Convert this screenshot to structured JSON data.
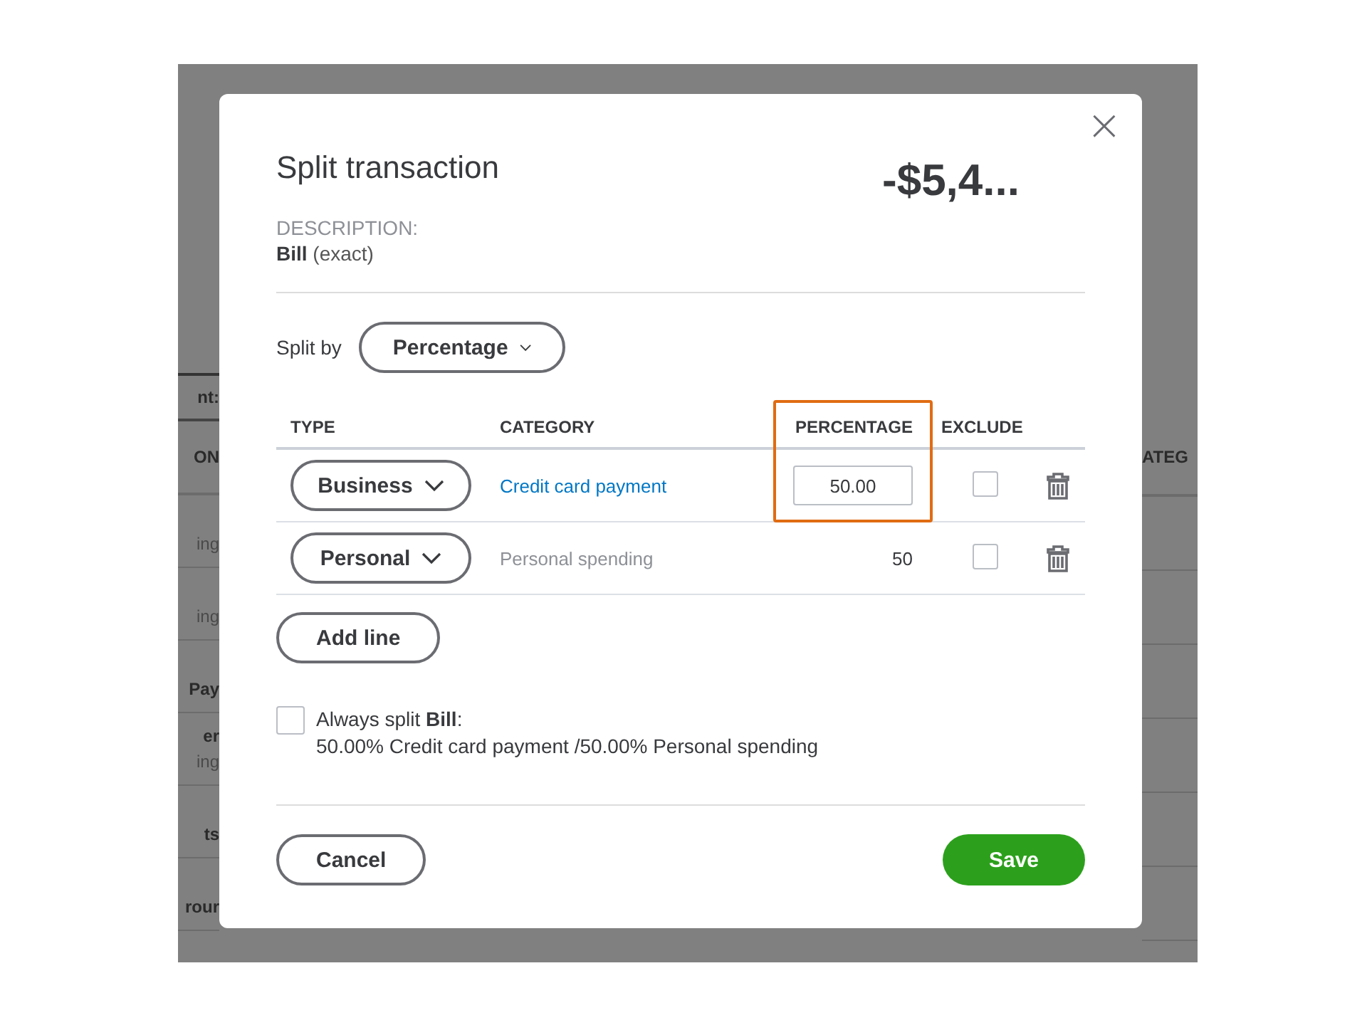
{
  "background_page": {
    "left_rows": [
      {
        "kind": "header",
        "lines": [
          {
            "text": "nt:",
            "kind": "strong"
          }
        ]
      },
      {
        "kind": "subheader",
        "lines": [
          {
            "text": "ON",
            "kind": "strong"
          }
        ]
      },
      {
        "kind": "row",
        "lines": [
          {
            "text": "ing",
            "kind": "muted"
          }
        ]
      },
      {
        "kind": "row",
        "lines": [
          {
            "text": "ing",
            "kind": "muted"
          }
        ]
      },
      {
        "kind": "row",
        "lines": [
          {
            "text": "Pay",
            "kind": "strong"
          }
        ]
      },
      {
        "kind": "row",
        "lines": [
          {
            "text": "er",
            "kind": "strong"
          },
          {
            "text": "ing",
            "kind": "muted"
          }
        ]
      },
      {
        "kind": "row",
        "lines": [
          {
            "text": "ts",
            "kind": "strong"
          }
        ]
      },
      {
        "kind": "row",
        "lines": [
          {
            "text": "rour",
            "kind": "strong"
          }
        ]
      }
    ],
    "right_header": "ATEG"
  },
  "dialog": {
    "title": "Split transaction",
    "close": "×",
    "amount": "-$5,4...",
    "description_label": "DESCRIPTION:",
    "description_name": "Bill",
    "description_match": "(exact)",
    "split_by_label": "Split by",
    "split_by_value": "Percentage",
    "columns": [
      {
        "label": "TYPE",
        "highlighted": false
      },
      {
        "label": "CATEGORY",
        "highlighted": false
      },
      {
        "label": "PERCENTAGE",
        "highlighted": true
      },
      {
        "label": "EXCLUDE",
        "highlighted": false
      }
    ],
    "rows": [
      {
        "type": "Business",
        "category": {
          "kind": "link",
          "text": "Credit card payment"
        },
        "percentage": {
          "kind": "input",
          "value": "50.00"
        },
        "exclude": false
      },
      {
        "type": "Personal",
        "category": {
          "kind": "plain",
          "text": "Personal spending"
        },
        "percentage": {
          "kind": "text",
          "value": "50"
        },
        "exclude": false
      }
    ],
    "add_line": "Add line",
    "always_split": {
      "checked": false,
      "text": "Always split **Bill**:",
      "summary": "50.00% Credit card payment /50.00% Personal spending"
    },
    "cancel": "Cancel",
    "save": "Save"
  }
}
